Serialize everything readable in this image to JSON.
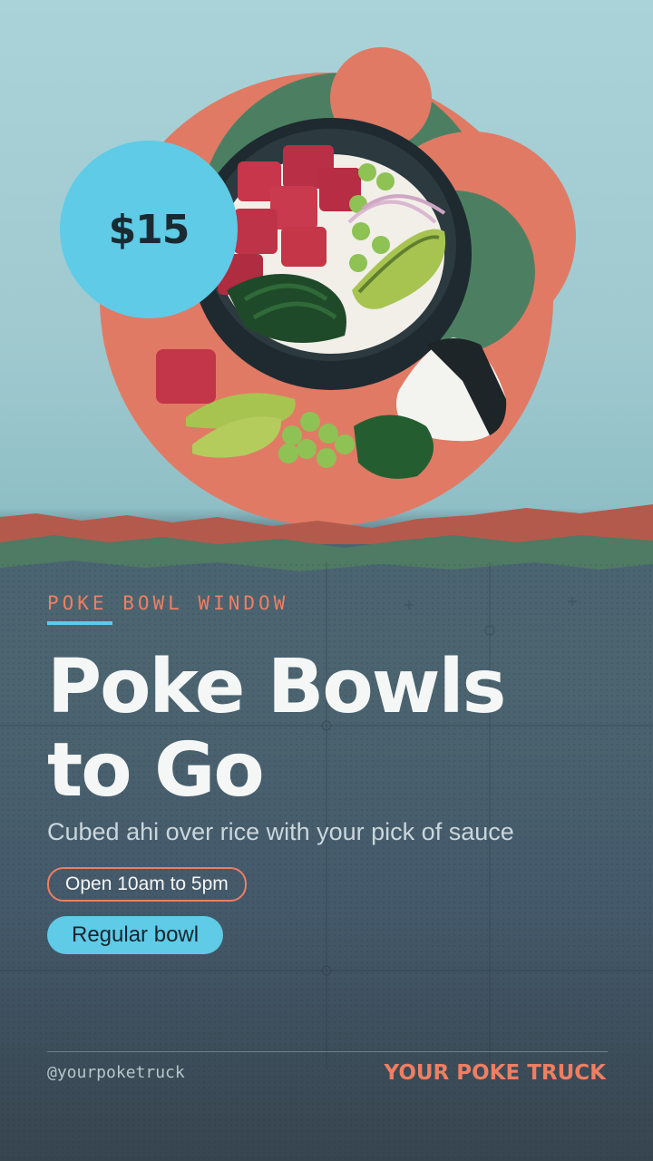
{
  "price": "$15",
  "eyebrow": "POKE BOWL WINDOW",
  "headline": {
    "line1": "Poke Bowls",
    "line2": "to Go"
  },
  "subtitle": "Cubed ahi over rice with your pick of sauce",
  "hours": "Open 10am to 5pm",
  "button_label": "Regular bowl",
  "handle": "@yourpoketruck",
  "brand": "YOUR POKE TRUCK",
  "colors": {
    "accent_coral": "#ef7e62",
    "accent_cyan": "#5fcbe6",
    "green": "#4a7a60",
    "text_light": "#f5f7f7"
  }
}
